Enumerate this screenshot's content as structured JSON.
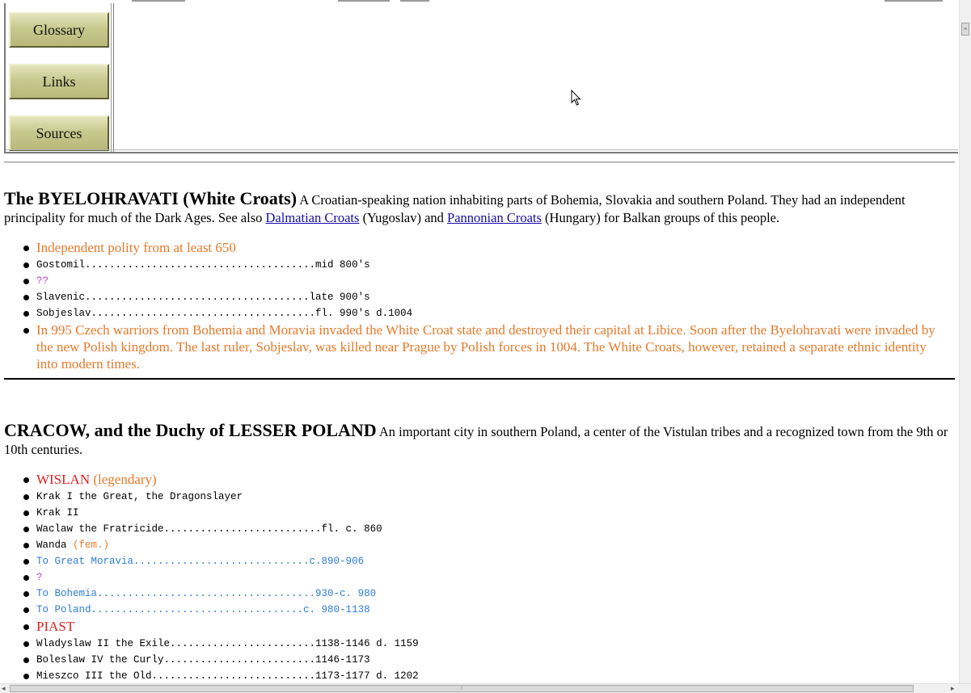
{
  "nav": {
    "buttons": [
      "Glossary",
      "Links",
      "Sources"
    ]
  },
  "sections": [
    {
      "title": "The BYELOHRAVATI (White Croats)",
      "intro_a": " A Croatian-speaking nation inhabiting parts of Bohemia, Slovakia and southern Poland. They had an independent principality for much of the Dark Ages. See also ",
      "link1": "Dalmatian Croats",
      "intro_b": " (Yugoslav) and ",
      "link2": "Pannonian Croats",
      "intro_c": " (Hungary) for Balkan groups of this people.",
      "items": [
        "Independent polity from at least 650",
        "Gostomil......................................mid 800's",
        "??",
        "Slavenic.....................................late 900's",
        "Sobjeslav.....................................fl. 990's d.1004",
        "In 995 Czech warriors from Bohemia and Moravia invaded the White Croat state and destroyed their capital at Libice. Soon after the Byelohravati were invaded by the new Polish kingdom. The last ruler, Sobjeslav, was killed near Prague by Polish forces in 1004. The White Croats, however, retained a separate ethnic identity into modern times."
      ]
    },
    {
      "title": "CRACOW, and the Duchy of LESSER POLAND",
      "intro": " An important city in southern Poland, a center of the Vistulan tribes and a recognized town from the 9th or 10th centuries.",
      "items": {
        "wislan": "WISLAN",
        "legendary": " (legendary)",
        "krak1": "Krak I the Great, the Dragonslayer",
        "krak2": "Krak II",
        "waclaw": "Waclaw the Fratricide..........................fl. c. 860",
        "wanda": "Wanda ",
        "wanda_fem": "(fem.)",
        "moravia": "To Great Moravia.............................c.890-906",
        "unknown": "?",
        "bohemia": "To Bohemia....................................930-c. 980",
        "poland": "To Poland...................................c. 980-1138",
        "piast": "PIAST",
        "wladyslaw": "Wladyslaw II the Exile........................1138-1146 d. 1159",
        "boleslaw": "Boleslaw IV the Curly.........................1146-1173",
        "mieszco": "Mieszco III the Old...........................1173-1177 d. 1202"
      }
    }
  ],
  "colors": {
    "orange": "#e8792a",
    "red": "#e02020",
    "blue": "#2e7dd6",
    "magenta": "#cc44cc",
    "button": "#c9c98f"
  },
  "icons": [
    "mouse-cursor-icon",
    "scrollbar-grip-icon",
    "scroll-left-arrow-icon",
    "scroll-right-arrow-icon"
  ]
}
